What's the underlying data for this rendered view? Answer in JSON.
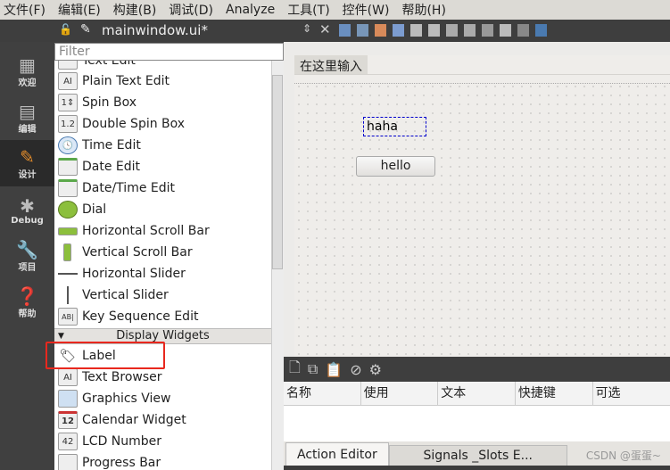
{
  "menu": [
    "文件(F)",
    "编辑(E)",
    "构建(B)",
    "调试(D)",
    "Analyze",
    "工具(T)",
    "控件(W)",
    "帮助(H)"
  ],
  "editor": {
    "file_name": "mainwindow.ui*"
  },
  "modes": [
    {
      "label": "欢迎",
      "icon": "grid-icon"
    },
    {
      "label": "编辑",
      "icon": "document-icon"
    },
    {
      "label": "设计",
      "icon": "pencil-icon",
      "active": true
    },
    {
      "label": "Debug",
      "icon": "bug-icon"
    },
    {
      "label": "项目",
      "icon": "wrench-icon"
    },
    {
      "label": "帮助",
      "icon": "help-icon"
    }
  ],
  "widget_box": {
    "filter_placeholder": "Filter",
    "items": [
      "Text Edit",
      "Plain Text Edit",
      "Spin Box",
      "Double Spin Box",
      "Time Edit",
      "Date Edit",
      "Date/Time Edit",
      "Dial",
      "Horizontal Scroll Bar",
      "Vertical Scroll Bar",
      "Horizontal Slider",
      "Vertical Slider",
      "Key Sequence Edit"
    ],
    "category": "Display Widgets",
    "display_items": [
      "Label",
      "Text Browser",
      "Graphics View",
      "Calendar Widget",
      "LCD Number",
      "Progress Bar"
    ]
  },
  "form": {
    "menu_placeholder": "在这里输入",
    "label_text": "haha",
    "button_text": "hello"
  },
  "action_editor": {
    "columns": [
      "名称",
      "使用",
      "文本",
      "快捷键",
      "可选"
    ],
    "tabs": [
      "Action Editor",
      "Signals _Slots E..."
    ]
  },
  "watermark": "CSDN @蛋蛋~",
  "colors": {
    "highlight": "#e8281e",
    "dark": "#3e3e3e"
  }
}
